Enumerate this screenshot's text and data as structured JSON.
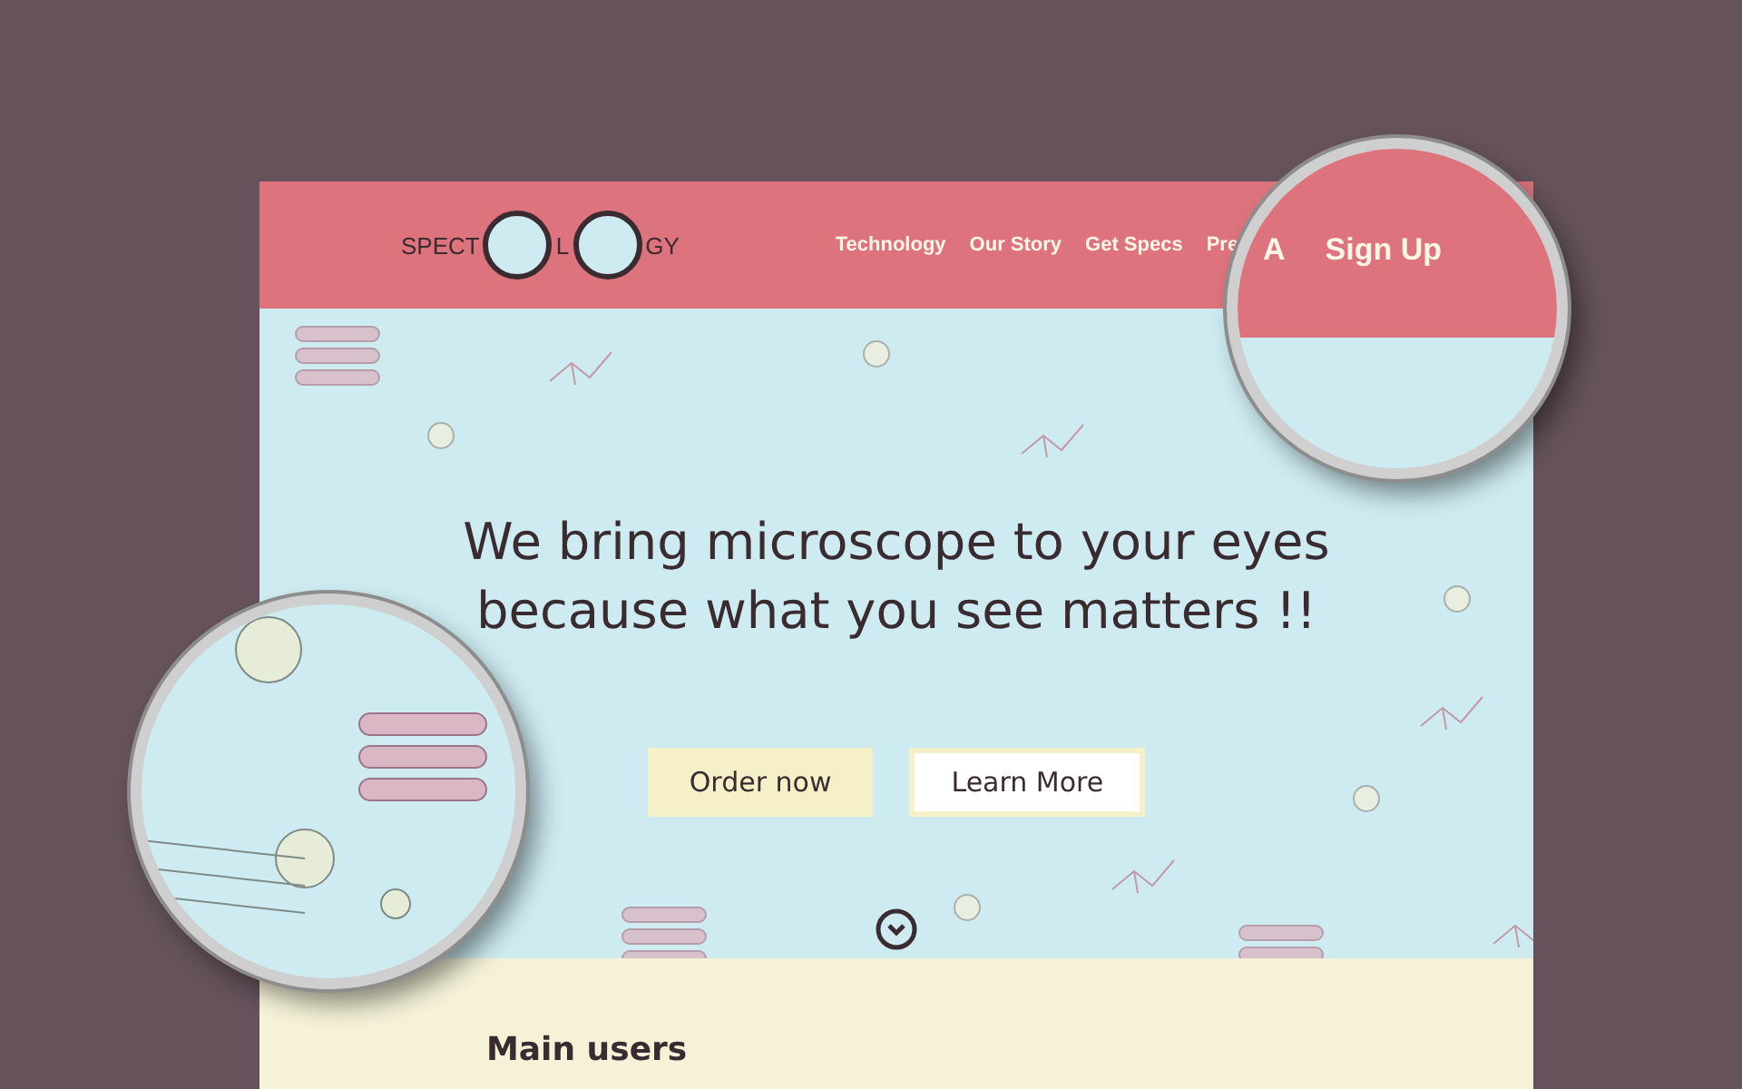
{
  "logo": {
    "parts": [
      "SPECT",
      "L",
      "GY"
    ]
  },
  "nav": {
    "items": [
      "Technology",
      "Our Story",
      "Get Specs",
      "Pre"
    ]
  },
  "magnified_nav": {
    "items": [
      "A",
      "Sign Up"
    ]
  },
  "hero": {
    "headline_lines": [
      "We bring microscope to your eyes",
      "because what you see matters !!"
    ],
    "buttons": [
      {
        "label": "Order now",
        "kind": "filled"
      },
      {
        "label": "Learn More",
        "kind": "outlined"
      }
    ]
  },
  "section": {
    "heading": "Main users"
  }
}
